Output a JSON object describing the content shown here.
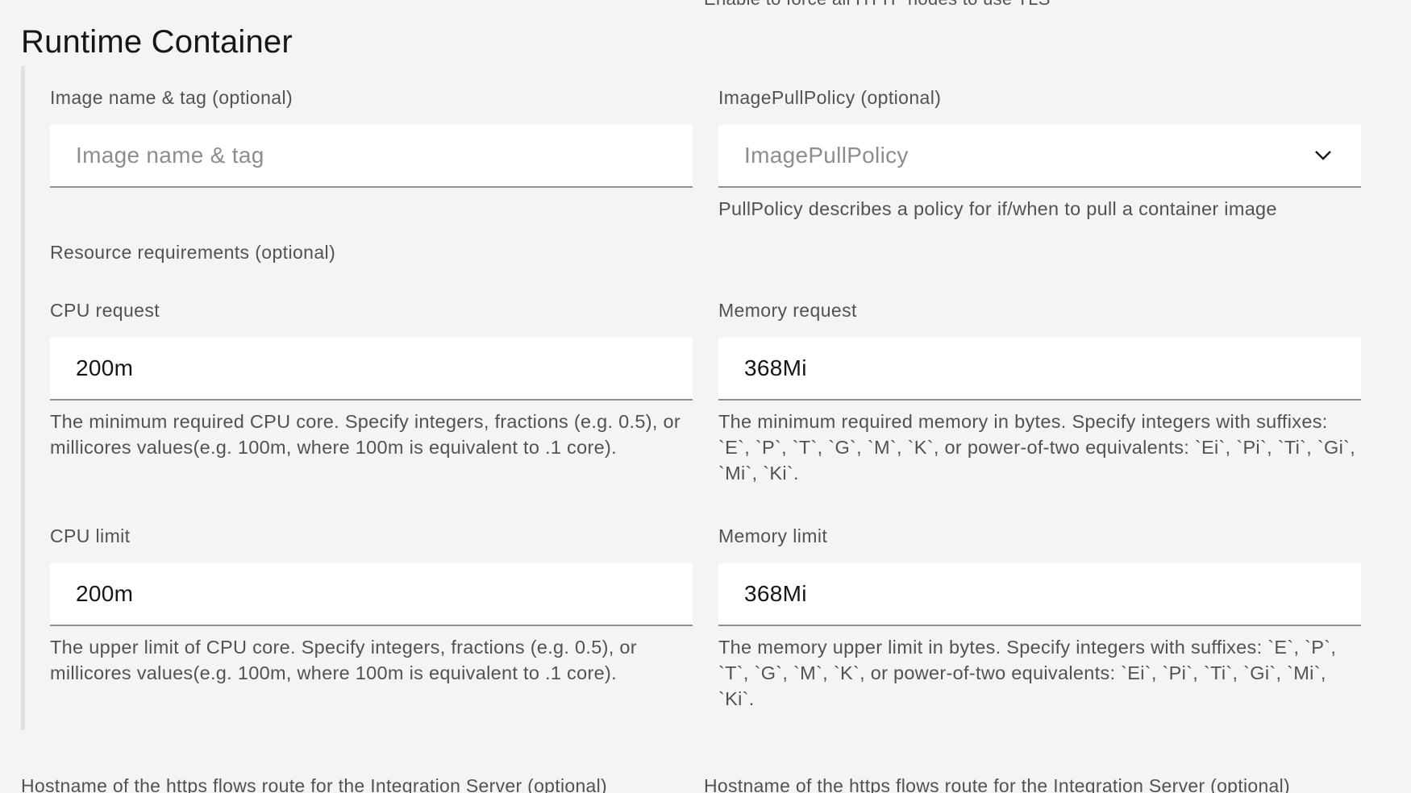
{
  "top_partial_text": "Enable to force all HTTP nodes to use TLS",
  "section": {
    "title": "Runtime Container"
  },
  "image": {
    "label": "Image name & tag (optional)",
    "placeholder": "Image name & tag",
    "value": ""
  },
  "pull_policy": {
    "label": "ImagePullPolicy (optional)",
    "placeholder": "ImagePullPolicy",
    "helper": "PullPolicy describes a policy for if/when to pull a container image",
    "icon": "chevron-down-icon"
  },
  "resources": {
    "label": "Resource requirements (optional)"
  },
  "cpu_request": {
    "label": "CPU request",
    "value": "200m",
    "helper": "The minimum required CPU core. Specify integers, fractions (e.g. 0.5), or millicores values(e.g. 100m, where 100m is equivalent to .1 core)."
  },
  "memory_request": {
    "label": "Memory request",
    "value": "368Mi",
    "helper": "The minimum required memory in bytes. Specify integers with suffixes: `E`, `P`, `T`, `G`, `M`, `K`, or power-of-two equivalents: `Ei`, `Pi`, `Ti`, `Gi`, `Mi`, `Ki`."
  },
  "cpu_limit": {
    "label": "CPU limit",
    "value": "200m",
    "helper": "The upper limit of CPU core. Specify integers, fractions (e.g. 0.5), or millicores values(e.g. 100m, where 100m is equivalent to .1 core)."
  },
  "memory_limit": {
    "label": "Memory limit",
    "value": "368Mi",
    "helper": "The memory upper limit in bytes. Specify integers with suffixes: `E`, `P`, `T`, `G`, `M`, `K`, or power-of-two equivalents: `Ei`, `Pi`, `Ti`, `Gi`, `Mi`, `Ki`."
  },
  "bottom_partial": {
    "left": "Hostname of the https flows route for the Integration Server (optional)",
    "right": "Hostname of the https flows route for the Integration Server (optional)"
  }
}
